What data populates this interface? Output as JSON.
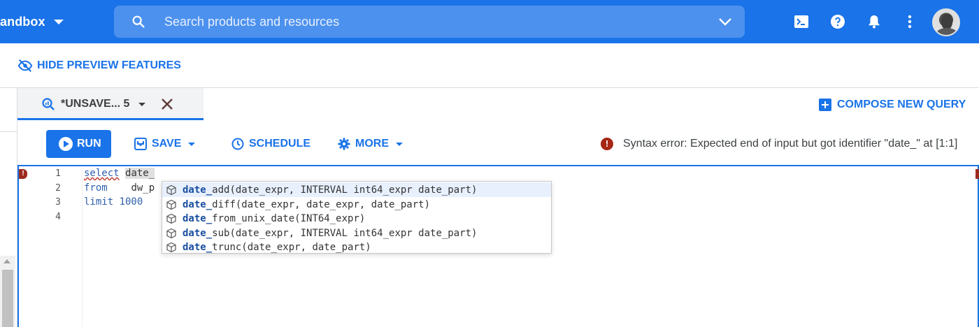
{
  "topbar": {
    "project_label": "andbox",
    "search_placeholder": "Search products and resources"
  },
  "preview": {
    "label": "HIDE PREVIEW FEATURES"
  },
  "tab": {
    "label": "*UNSAVE... 5"
  },
  "compose": {
    "label": "COMPOSE NEW QUERY"
  },
  "toolbar": {
    "run_label": "RUN",
    "save_label": "SAVE",
    "schedule_label": "SCHEDULE",
    "more_label": "MORE",
    "error_text": "Syntax error: Expected end of input but got identifier \"date_\" at [1:1]"
  },
  "editor": {
    "line_numbers": [
      "1",
      "2",
      "3",
      "4"
    ],
    "line1_keyword": "select",
    "line1_token": "date_",
    "line2_keyword": "from",
    "line2_rest": "dw_p",
    "line3": "limit 1000"
  },
  "autocomplete": {
    "match": "date_",
    "items": [
      {
        "rest": "add(date_expr, INTERVAL int64_expr date_part)"
      },
      {
        "rest": "diff(date_expr, date_expr, date_part)"
      },
      {
        "rest": "from_unix_date(INT64_expr)"
      },
      {
        "rest": "sub(date_expr, INTERVAL int64_expr date_part)"
      },
      {
        "rest": "trunc(date_expr, date_part)"
      }
    ]
  },
  "colors": {
    "brand_blue": "#1a73e8",
    "error_red": "#a52714"
  }
}
